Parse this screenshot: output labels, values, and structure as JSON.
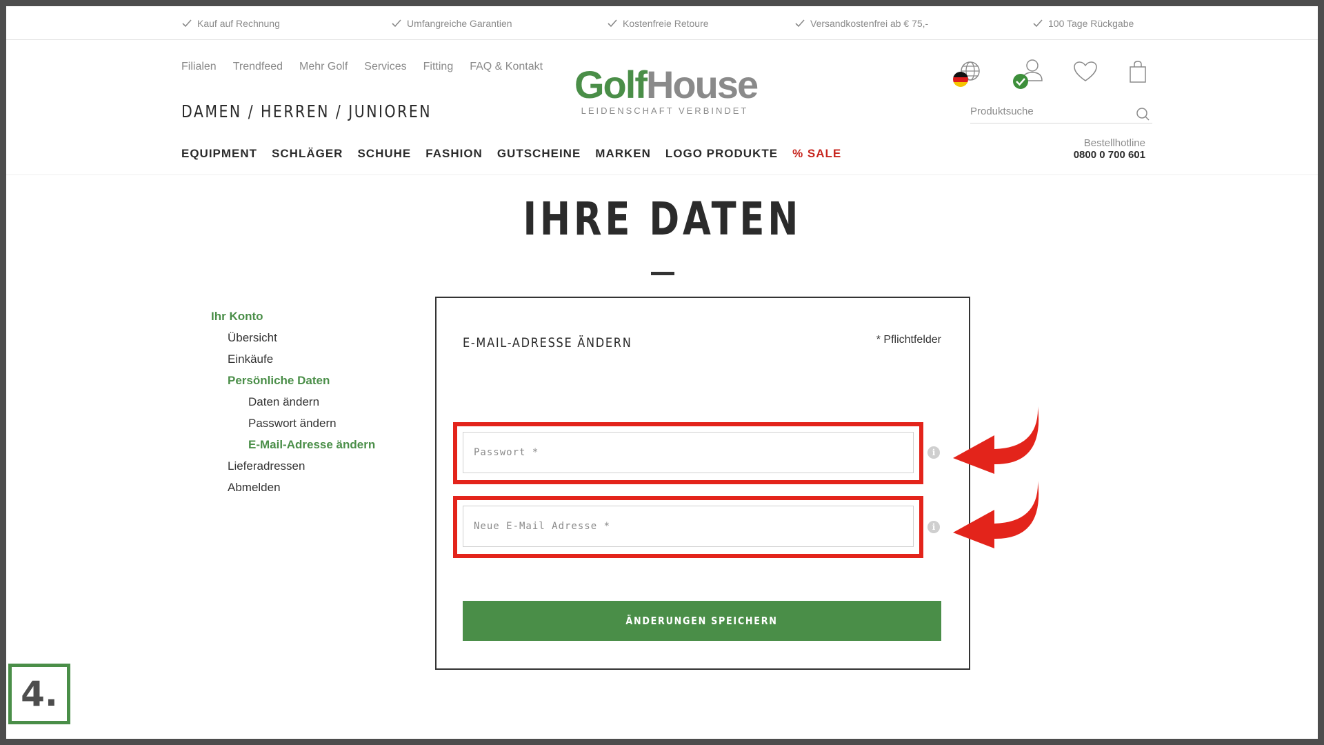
{
  "usp": [
    "Kauf auf Rechnung",
    "Umfangreiche Garantien",
    "Kostenfreie Retoure",
    "Versandkostenfrei ab € 75,-",
    "100 Tage Rückgabe"
  ],
  "service_nav": [
    "Filialen",
    "Trendfeed",
    "Mehr Golf",
    "Services",
    "Fitting",
    "FAQ & Kontakt"
  ],
  "gender_nav": "DAMEN  /  HERREN  /  JUNIOREN",
  "logo": {
    "golf": "Golf",
    "house": "House",
    "tagline": "LEIDENSCHAFT VERBINDET"
  },
  "main_nav": [
    "EQUIPMENT",
    "SCHLÄGER",
    "SCHUHE",
    "FASHION",
    "GUTSCHEINE",
    "MARKEN",
    "LOGO PRODUKTE",
    "% SALE"
  ],
  "search": {
    "placeholder": "Produktsuche"
  },
  "hotline": {
    "label": "Bestellhotline",
    "number": "0800 0 700 601"
  },
  "page_title": "IHRE DATEN",
  "sidebar": {
    "account": "Ihr Konto",
    "overview": "Übersicht",
    "purchases": "Einkäufe",
    "personal": "Persönliche Daten",
    "change_data": "Daten ändern",
    "change_password": "Passwort ändern",
    "change_email": "E-Mail-Adresse ändern",
    "addresses": "Lieferadressen",
    "logout": "Abmelden"
  },
  "form": {
    "title": "E-MAIL-ADRESSE ÄNDERN",
    "required_note": "* Pflichtfelder",
    "password_placeholder": "Passwort *",
    "password_value": "",
    "email_placeholder": "Neue E-Mail Adresse *",
    "email_value": "",
    "submit_label": "ÄNDERUNGEN SPEICHERN",
    "info_glyph": "i"
  },
  "step_label": "4.",
  "colors": {
    "brand_green": "#4a8e48",
    "sale_red": "#c7261f",
    "highlight_red": "#e3241b",
    "frame_gray": "#4d4d4d"
  }
}
